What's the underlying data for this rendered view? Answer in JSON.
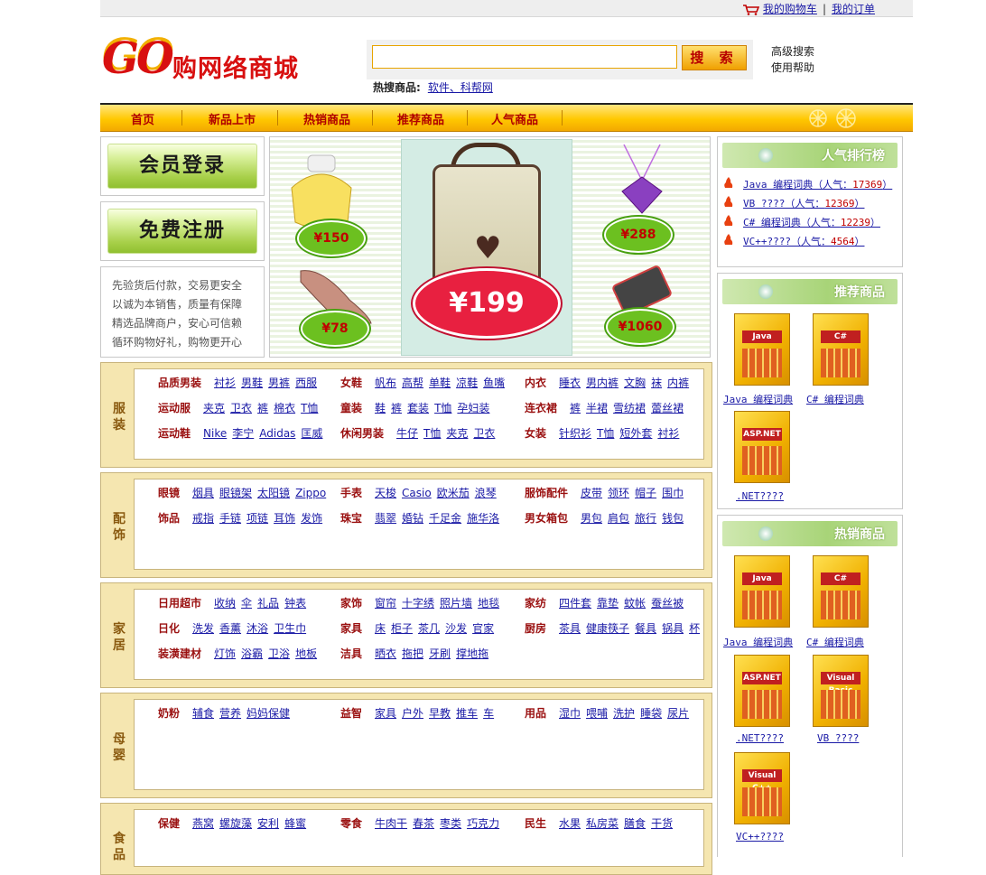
{
  "topbar": {
    "cart": "我的购物车",
    "orders": "我的订单",
    "sep": "|"
  },
  "logo": {
    "go": "GO",
    "name": "购网络商城"
  },
  "search": {
    "button": "搜 索",
    "value": "",
    "hot_label": "热搜商品:",
    "hot_link": "软件、科帮网",
    "advanced": "高级搜索",
    "help": "使用帮助"
  },
  "nav": [
    "首页",
    "新品上市",
    "热销商品",
    "推荐商品",
    "人气商品"
  ],
  "left": {
    "login": "会员登录",
    "register": "免费注册",
    "notice": [
      "先验货后付款，交易更安全",
      "以诚为本销售，质量有保障",
      "精选品牌商户，安心可信赖",
      "循环购物好礼，购物更开心"
    ]
  },
  "banner": {
    "prices": [
      "¥150",
      "¥288",
      "¥78",
      "¥1060",
      "¥199"
    ]
  },
  "rank": {
    "title": "人气排行榜",
    "items": [
      {
        "name": "Java 编程词典（人气：",
        "pop": "17369",
        "end": "）"
      },
      {
        "name": "VB ????（人气：",
        "pop": "12369",
        "end": "）"
      },
      {
        "name": "C# 编程词典（人气：",
        "pop": "12239",
        "end": "）"
      },
      {
        "name": "VC++????（人气：",
        "pop": "4564",
        "end": "）"
      }
    ]
  },
  "recommend": {
    "title": "推荐商品",
    "books": [
      "Java 编程词典",
      "C# 编程词典",
      ".NET????"
    ],
    "covers": [
      "Java",
      "C#",
      "ASP.NET"
    ]
  },
  "hot": {
    "title": "热销商品",
    "books": [
      "Java 编程词典",
      "C# 编程词典",
      ".NET????",
      "VB ????",
      "VC++????"
    ],
    "covers": [
      "Java",
      "C#",
      "ASP.NET",
      "Visual Basic",
      "Visual C++"
    ]
  },
  "categories": [
    {
      "label": "服装",
      "rows": [
        [
          {
            "t": "品质男装",
            "links": [
              "衬衫",
              "男鞋",
              "男裤",
              "西服"
            ]
          },
          {
            "t": "女鞋",
            "links": [
              "帆布",
              "高帮",
              "单鞋",
              "凉鞋",
              "鱼嘴"
            ]
          },
          {
            "t": "内衣",
            "links": [
              "睡衣",
              "男内裤",
              "文胸",
              "袜",
              "内裤"
            ]
          }
        ],
        [
          {
            "t": "运动服",
            "links": [
              "夹克",
              "卫衣",
              "裤",
              "棉衣",
              "T恤"
            ]
          },
          {
            "t": "童装",
            "links": [
              "鞋",
              "裤",
              "套装",
              "T恤",
              "孕妇装"
            ]
          },
          {
            "t": "连衣裙",
            "links": [
              "裤",
              "半裙",
              "雪纺裙",
              "蕾丝裙"
            ]
          }
        ],
        [
          {
            "t": "运动鞋",
            "links": [
              "Nike",
              "李宁",
              "Adidas",
              "匡威"
            ]
          },
          {
            "t": "休闲男装",
            "links": [
              "牛仔",
              "T恤",
              "夹克",
              "卫衣"
            ]
          },
          {
            "t": "女装",
            "links": [
              "针织衫",
              "T恤",
              "短外套",
              "衬衫"
            ]
          }
        ]
      ]
    },
    {
      "label": "配饰",
      "rows": [
        [
          {
            "t": "眼镜",
            "links": [
              "烟具",
              "眼镜架",
              "太阳镜",
              "Zippo"
            ]
          },
          {
            "t": "手表",
            "links": [
              "天梭",
              "Casio",
              "欧米茄",
              "浪琴"
            ]
          },
          {
            "t": "服饰配件",
            "links": [
              "皮带",
              "领环",
              "帽子",
              "围巾"
            ]
          }
        ],
        [
          {
            "t": "饰品",
            "links": [
              "戒指",
              "手链",
              "项链",
              "耳饰",
              "发饰"
            ]
          },
          {
            "t": "珠宝",
            "links": [
              "翡翠",
              "婚钻",
              "千足金",
              "施华洛"
            ]
          },
          {
            "t": "男女箱包",
            "links": [
              "男包",
              "肩包",
              "旅行",
              "钱包"
            ]
          }
        ]
      ]
    },
    {
      "label": "家居",
      "rows": [
        [
          {
            "t": "日用超市",
            "links": [
              "收纳",
              "伞",
              "礼品",
              "钟表"
            ]
          },
          {
            "t": "家饰",
            "links": [
              "窗帘",
              "十字绣",
              "照片墙",
              "地毯"
            ]
          },
          {
            "t": "家纺",
            "links": [
              "四件套",
              "靠垫",
              "蚊帐",
              "蚕丝被"
            ]
          }
        ],
        [
          {
            "t": "日化",
            "links": [
              "洗发",
              "香薰",
              "沐浴",
              "卫生巾"
            ]
          },
          {
            "t": "家具",
            "links": [
              "床",
              "柜子",
              "茶几",
              "沙发",
              "官家"
            ]
          },
          {
            "t": "厨房",
            "links": [
              "茶具",
              "健康筷子",
              "餐具",
              "锅具",
              "杯"
            ]
          }
        ],
        [
          {
            "t": "装潢建材",
            "links": [
              "灯饰",
              "浴霸",
              "卫浴",
              "地板"
            ]
          },
          {
            "t": "洁具",
            "links": [
              "晒衣",
              "拖把",
              "牙刷",
              "撑地拖"
            ]
          }
        ]
      ]
    },
    {
      "label": "母婴",
      "rows": [
        [
          {
            "t": "奶粉",
            "links": [
              "辅食",
              "营养",
              "妈妈保健"
            ]
          },
          {
            "t": "益智",
            "links": [
              "家具",
              "户外",
              "早教",
              "推车",
              "车"
            ]
          },
          {
            "t": "用品",
            "links": [
              "湿巾",
              "喂哺",
              "洗护",
              "睡袋",
              "尿片"
            ]
          }
        ]
      ]
    },
    {
      "label": "食品",
      "rows": [
        [
          {
            "t": "保健",
            "links": [
              "燕窝",
              "螺旋藻",
              "安利",
              "蜂蜜"
            ]
          },
          {
            "t": "零食",
            "links": [
              "牛肉干",
              "春茶",
              "枣类",
              "巧克力"
            ]
          },
          {
            "t": "民生",
            "links": [
              "水果",
              "私房菜",
              "膳食",
              "干货"
            ]
          }
        ]
      ]
    }
  ]
}
